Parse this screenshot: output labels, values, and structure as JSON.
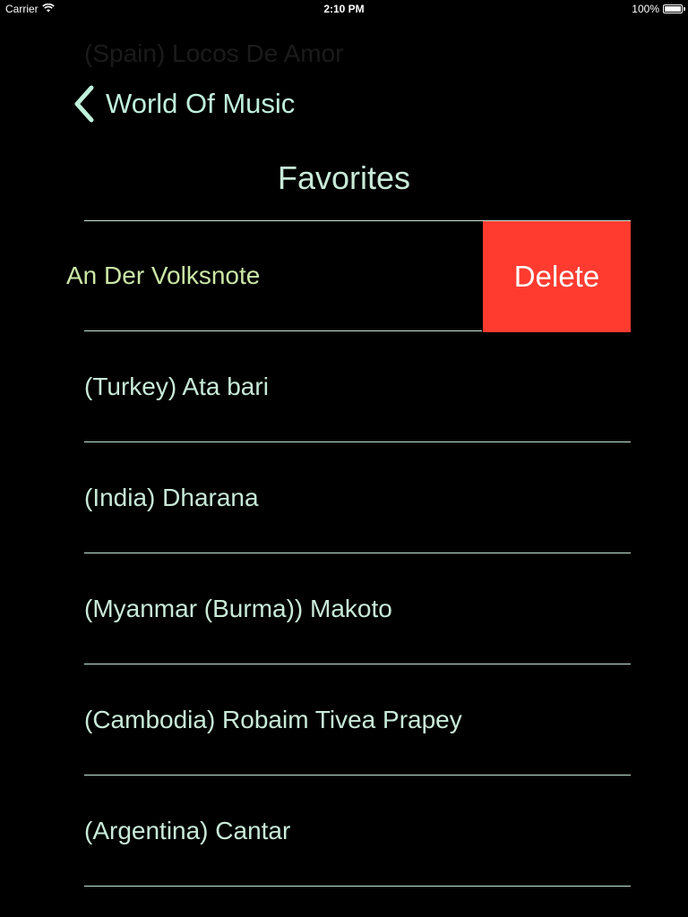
{
  "status_bar": {
    "carrier": "Carrier",
    "time": "2:10 PM",
    "battery": "100%"
  },
  "now_playing": "(Spain) Locos De Amor",
  "nav": {
    "back_label": "World Of Music"
  },
  "title": "Favorites",
  "favorites": [
    {
      "label": "An Der Volksnote",
      "swiped": true
    },
    {
      "label": "(Turkey) Ata bari"
    },
    {
      "label": "(India) Dharana"
    },
    {
      "label": "(Myanmar (Burma)) Makoto"
    },
    {
      "label": "(Cambodia) Robaim Tivea Prapey"
    },
    {
      "label": "(Argentina) Cantar"
    }
  ],
  "delete_label": "Delete",
  "colors": {
    "background": "#000000",
    "text": "#c8ead8",
    "accent": "#bff0dc",
    "swiped_text": "#cbe7a6",
    "delete": "#ff3b30"
  }
}
